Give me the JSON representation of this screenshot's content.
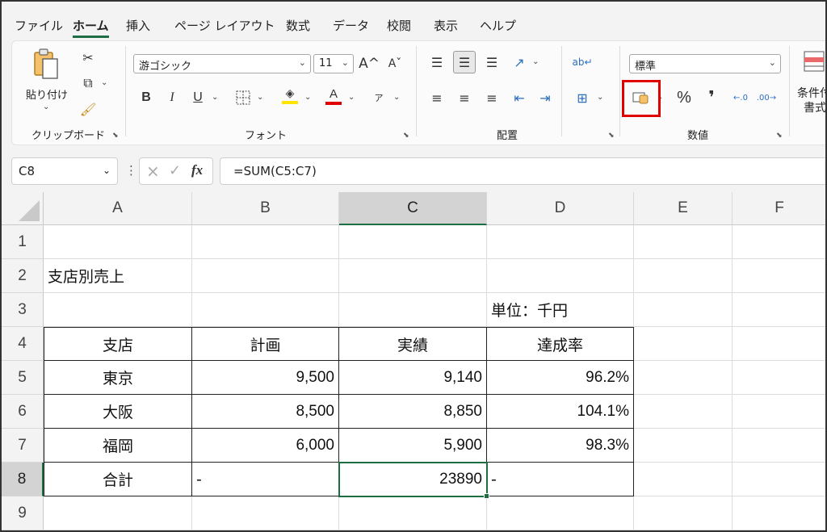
{
  "menu": {
    "tabs": [
      "ファイル",
      "ホーム",
      "挿入",
      "ページ レイアウト",
      "数式",
      "データ",
      "校閲",
      "表示",
      "ヘルプ"
    ],
    "active": "ホーム"
  },
  "ribbon": {
    "clipboard": {
      "paste_label": "貼り付け",
      "group_label": "クリップボード"
    },
    "font": {
      "font_name": "游ゴシック",
      "font_size": "11",
      "grow_icon": "A^",
      "shrink_icon": "Aˇ",
      "group_label": "フォント",
      "fill_color": "#ffe400",
      "font_color": "#e00000"
    },
    "alignment": {
      "group_label": "配置"
    },
    "number": {
      "format": "標準",
      "percent_label": "%",
      "comma_label": "❜",
      "group_label": "数値"
    },
    "styles": {
      "conditional_label_1": "条件付",
      "conditional_label_2": "書式"
    }
  },
  "formula_bar": {
    "name_box": "C8",
    "cancel_icon": "×",
    "enter_icon": "✓",
    "fx_label": "fx",
    "formula": "=SUM(C5:C7)"
  },
  "sheet": {
    "columns": [
      "A",
      "B",
      "C",
      "D",
      "E",
      "F"
    ],
    "selected_column": "C",
    "rows": [
      "1",
      "2",
      "3",
      "4",
      "5",
      "6",
      "7",
      "8",
      "9"
    ],
    "selected_row": "8",
    "title": "支店別売上",
    "unit": "単位：千円",
    "headers": [
      "支店",
      "計画",
      "実績",
      "達成率"
    ],
    "data": [
      {
        "branch": "東京",
        "plan": "9,500",
        "actual": "9,140",
        "rate": "96.2%"
      },
      {
        "branch": "大阪",
        "plan": "8,500",
        "actual": "8,850",
        "rate": "104.1%"
      },
      {
        "branch": "福岡",
        "plan": "6,000",
        "actual": "5,900",
        "rate": "98.3%"
      }
    ],
    "total": {
      "label": "合計",
      "plan": "-",
      "actual": "23890",
      "rate": "-"
    }
  },
  "colors": {
    "excel_green": "#1e6e43",
    "highlight_red": "#e00000"
  }
}
